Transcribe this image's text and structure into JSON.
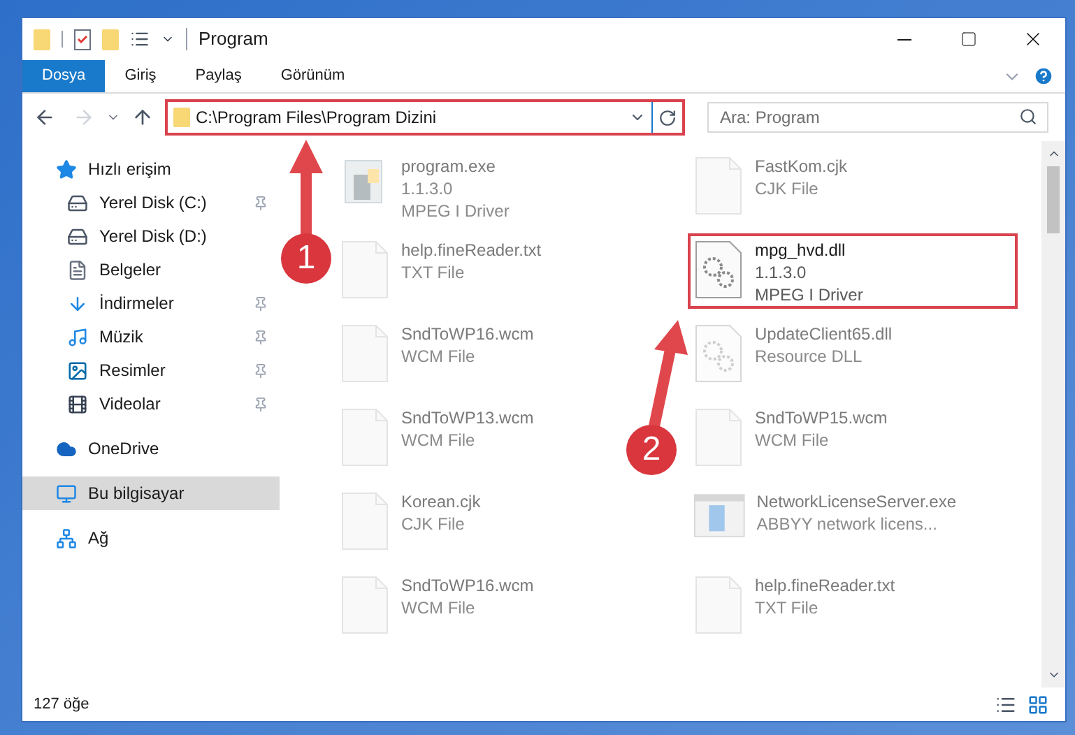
{
  "window": {
    "title": "Program"
  },
  "ribbon_tabs": [
    {
      "label": "Dosya",
      "selected": true
    },
    {
      "label": "Giriş",
      "selected": false
    },
    {
      "label": "Paylaş",
      "selected": false
    },
    {
      "label": "Görünüm",
      "selected": false
    }
  ],
  "address_bar": {
    "path": "C:\\Program Files\\Program Dizini",
    "highlighted": true
  },
  "search": {
    "placeholder": "Ara: Program"
  },
  "sidebar": {
    "items": [
      {
        "label": "Hızlı erişim",
        "kind": "star",
        "pinned": false,
        "selected": false,
        "children": [
          {
            "label": "Yerel Disk (C:)",
            "kind": "drive-c",
            "pinned": true,
            "selected": false
          },
          {
            "label": "Yerel Disk (D:)",
            "kind": "drive",
            "pinned": false,
            "selected": false
          },
          {
            "label": "Belgeler",
            "kind": "docs",
            "pinned": false,
            "selected": false
          },
          {
            "label": "İndirmeler",
            "kind": "download",
            "pinned": true,
            "selected": false
          },
          {
            "label": "Müzik",
            "kind": "music",
            "pinned": true,
            "selected": false
          },
          {
            "label": "Resimler",
            "kind": "pictures",
            "pinned": true,
            "selected": false
          },
          {
            "label": "Videolar",
            "kind": "videos",
            "pinned": true,
            "selected": false
          }
        ]
      },
      {
        "label": "OneDrive",
        "kind": "cloud",
        "pinned": false,
        "selected": false
      },
      {
        "label": "Bu bilgisayar",
        "kind": "computer",
        "pinned": false,
        "selected": true
      },
      {
        "label": "Ağ",
        "kind": "network",
        "pinned": false,
        "selected": false
      }
    ]
  },
  "files": [
    {
      "name": "program.exe",
      "details": [
        "1.1.3.0",
        "MPEG I Driver"
      ],
      "kind": "app",
      "highlighted": false
    },
    {
      "name": "FastKom.cjk",
      "details": [
        "CJK File"
      ],
      "kind": "blank",
      "highlighted": false
    },
    {
      "name": "help.fineReader.txt",
      "details": [
        "TXT File"
      ],
      "kind": "blank",
      "highlighted": false
    },
    {
      "name": "mpg_hvd.dll",
      "details": [
        "1.1.3.0",
        "MPEG I Driver"
      ],
      "kind": "gears",
      "highlighted": true
    },
    {
      "name": "SndToWP16.wcm",
      "details": [
        "WCM File"
      ],
      "kind": "blank",
      "highlighted": false
    },
    {
      "name": "UpdateClient65.dll",
      "details": [
        "Resource DLL"
      ],
      "kind": "gears",
      "highlighted": false
    },
    {
      "name": "SndToWP13.wcm",
      "details": [
        "WCM File"
      ],
      "kind": "blank",
      "highlighted": false
    },
    {
      "name": "SndToWP15.wcm",
      "details": [
        "WCM File"
      ],
      "kind": "blank",
      "highlighted": false
    },
    {
      "name": "Korean.cjk",
      "details": [
        "CJK File"
      ],
      "kind": "blank",
      "highlighted": false
    },
    {
      "name": "NetworkLicenseServer.exe",
      "details": [
        "ABBYY network licens..."
      ],
      "kind": "window",
      "highlighted": false
    },
    {
      "name": "SndToWP16.wcm",
      "details": [
        "WCM File"
      ],
      "kind": "blank",
      "highlighted": false
    },
    {
      "name": "help.fineReader.txt",
      "details": [
        "TXT File"
      ],
      "kind": "blank",
      "highlighted": false
    }
  ],
  "status_bar": {
    "item_count": "127 öğe"
  },
  "annotations": [
    {
      "label": "1"
    },
    {
      "label": "2"
    }
  ]
}
